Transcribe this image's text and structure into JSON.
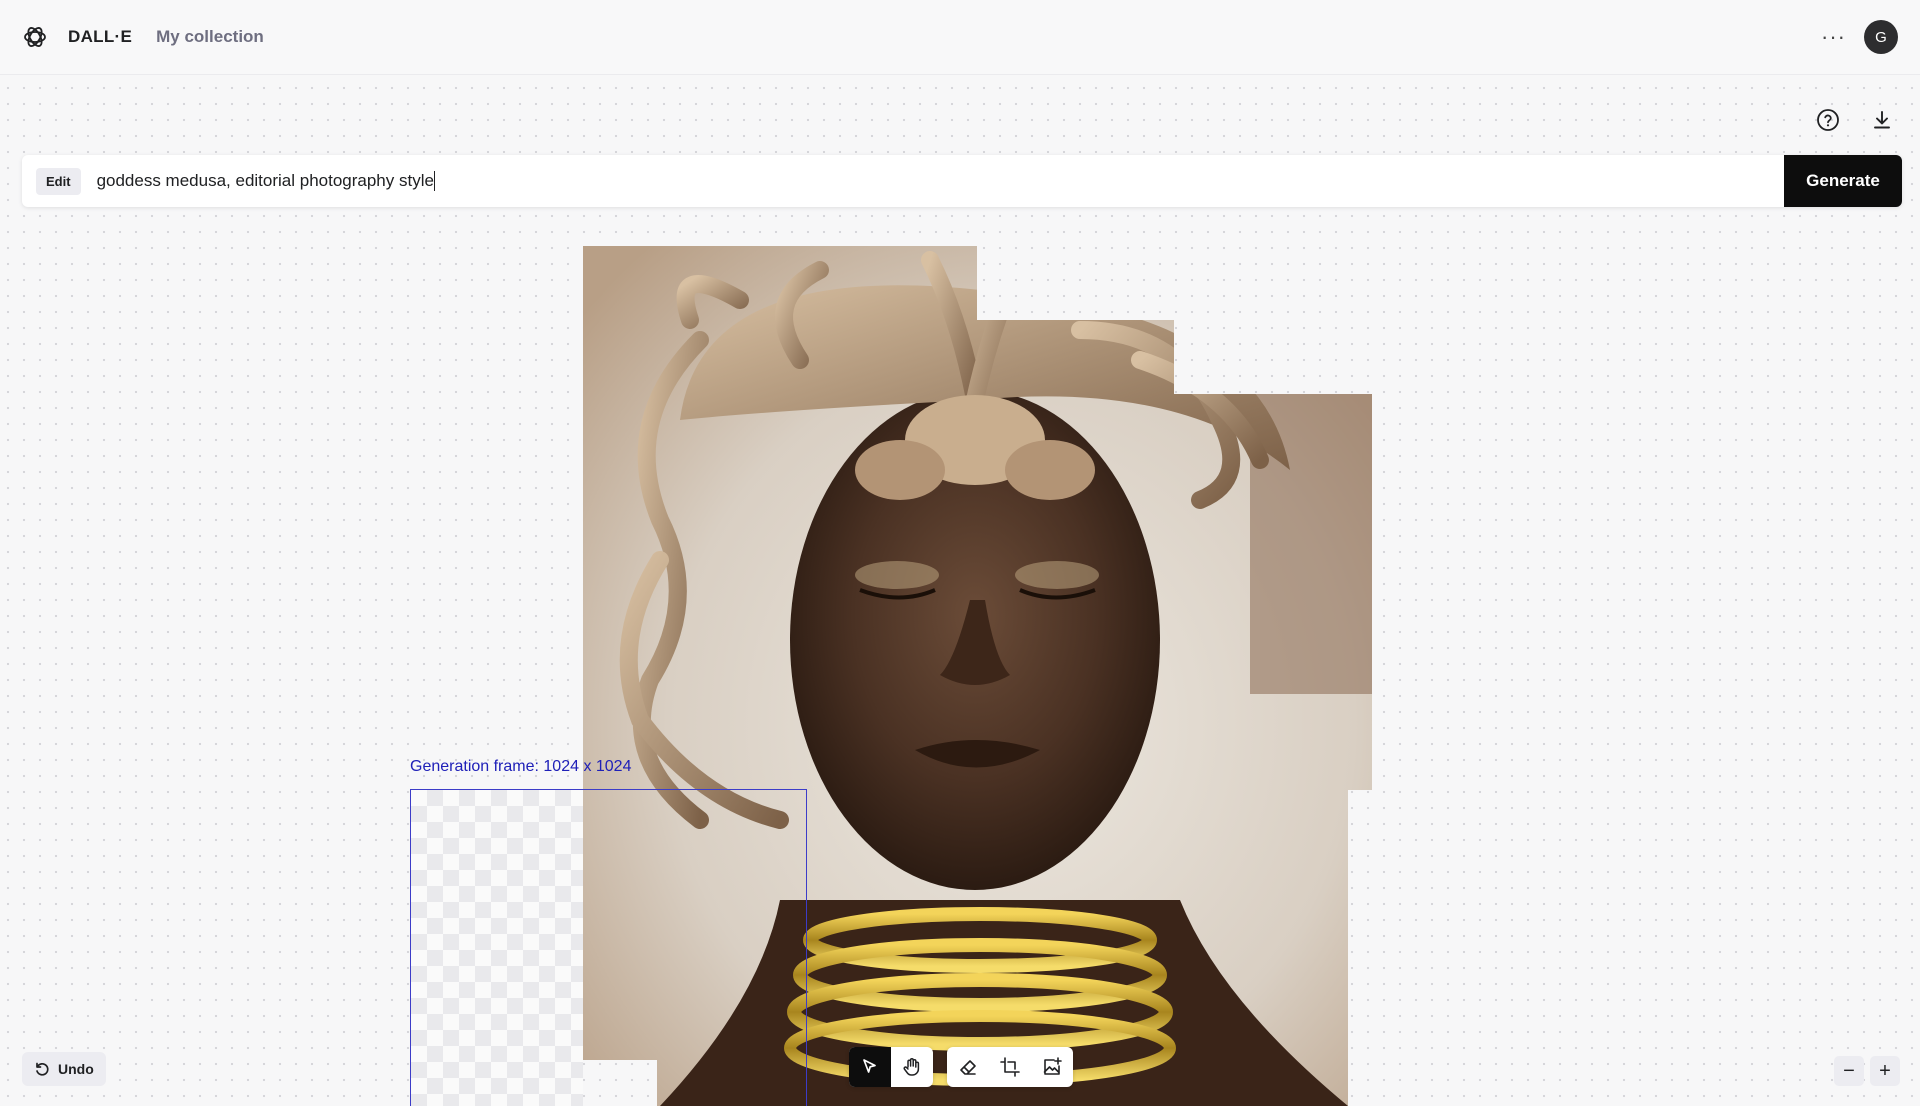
{
  "header": {
    "brand": "DALL·E",
    "nav_collection": "My collection",
    "avatar_initial": "G",
    "more_icon": "ellipsis-icon"
  },
  "tools": {
    "help_icon": "help-circle-icon",
    "download_icon": "download-icon"
  },
  "prompt": {
    "mode_badge": "Edit",
    "value": "goddess medusa, editorial photography style",
    "generate_label": "Generate"
  },
  "canvas": {
    "generation_frame_label": "Generation frame: 1024 x 1024"
  },
  "toolbar": {
    "tools": [
      "select-arrow-icon",
      "hand-pan-icon",
      "eraser-icon",
      "add-frame-icon",
      "upload-image-icon"
    ],
    "active_tool": "select-arrow-icon"
  },
  "footer": {
    "undo_label": "Undo",
    "zoom_out": "−",
    "zoom_in": "+"
  },
  "colors": {
    "accent_frame": "#3c3cc8",
    "generate_bg": "#0d0d0d"
  }
}
